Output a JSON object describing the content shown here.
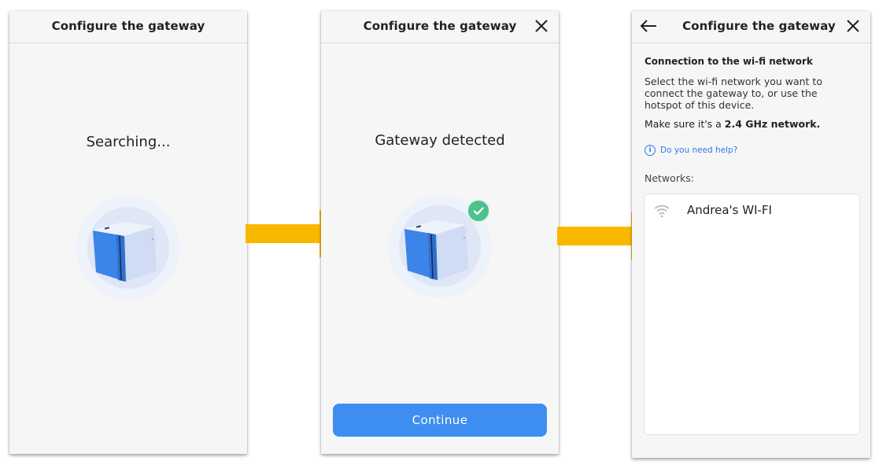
{
  "screens": [
    {
      "title": "Configure the gateway",
      "status": "Searching..."
    },
    {
      "title": "Configure the gateway",
      "status": "Gateway detected",
      "continue_label": "Continue"
    },
    {
      "title": "Configure the gateway",
      "heading": "Connection to the wi-fi network",
      "description": "Select the wi-fi network you want to connect the gateway to, or use the hotspot of this device.",
      "note_prefix": "Make sure it's a ",
      "note_bold": "2.4 GHz network.",
      "help_link": "Do you need help?",
      "networks_label": "Networks:",
      "networks": [
        {
          "name": "Andrea's WI-FI",
          "icon": "wifi-icon"
        }
      ]
    }
  ],
  "colors": {
    "accent": "#3d8ef0",
    "arrow": "#f9b800",
    "success": "#4fc08d",
    "device_blue": "#3b84e8",
    "halo": "#e3ebf8"
  }
}
